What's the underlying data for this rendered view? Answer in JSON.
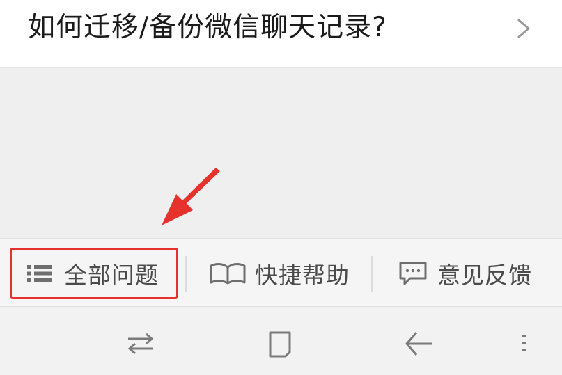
{
  "faq": {
    "question": "如何迁移/备份微信聊天记录?"
  },
  "bottom_tabs": [
    {
      "label": "全部问题",
      "icon": "list-icon"
    },
    {
      "label": "快捷帮助",
      "icon": "book-icon"
    },
    {
      "label": "意见反馈",
      "icon": "chat-bubble-icon"
    }
  ],
  "nav_bar": {
    "buttons": [
      "switch-apps-icon",
      "home-square-icon",
      "back-arrow-icon",
      "menu-dots-icon"
    ]
  },
  "colors": {
    "annotation": "#e5322d",
    "icon_gray": "#6e6e6e",
    "text": "#1b1b1b",
    "background": "#efeff0"
  }
}
